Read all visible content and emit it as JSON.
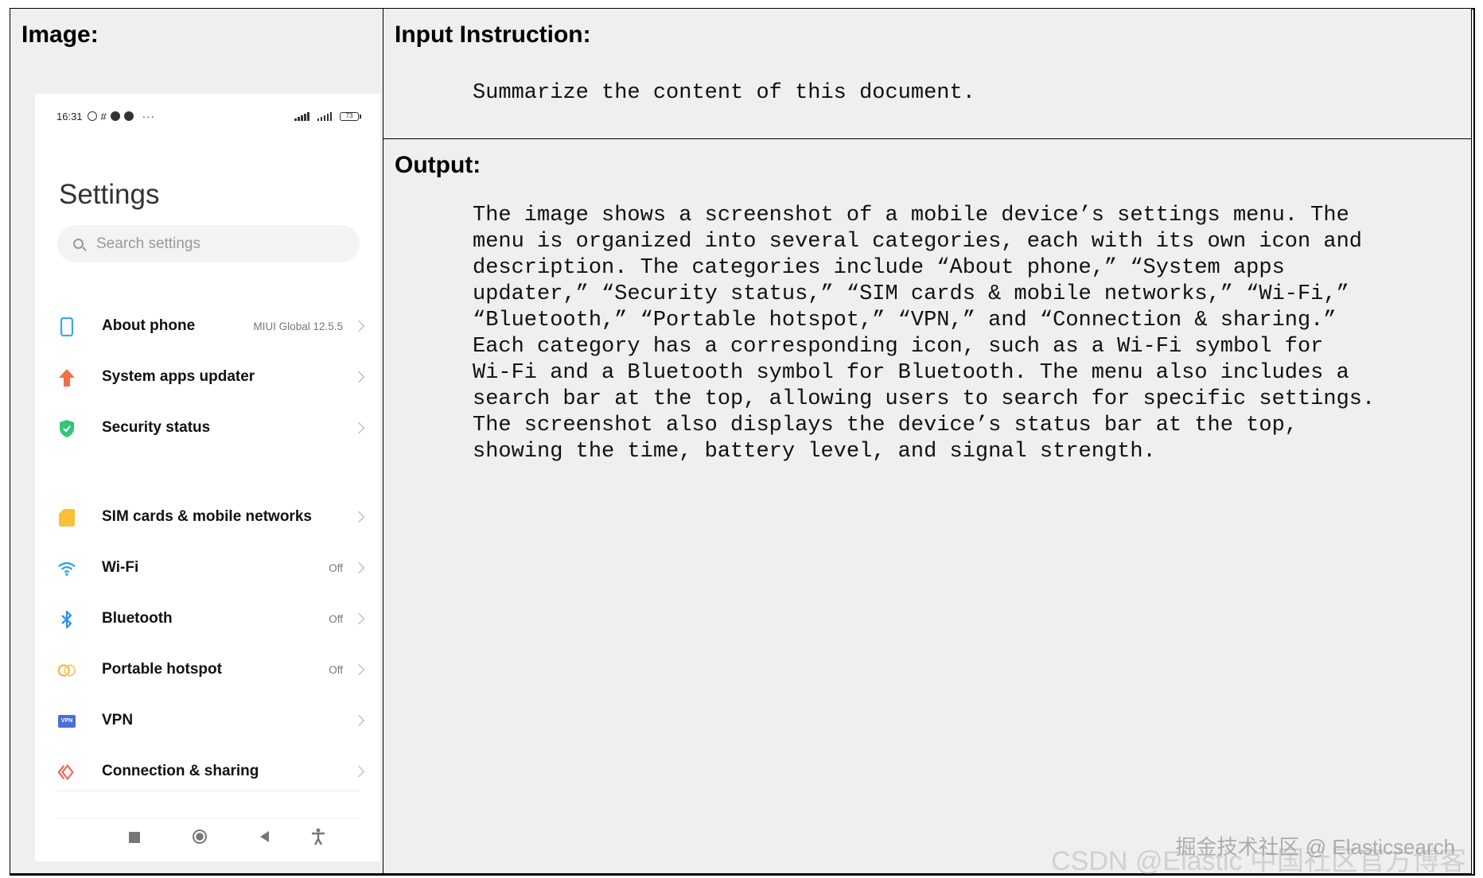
{
  "headers": {
    "image": "Image:",
    "instruction": "Input Instruction:",
    "output": "Output:"
  },
  "instruction_text": "Summarize the content of this document.",
  "output_lines": [
    "The image shows a screenshot of a mobile device’s settings menu. The",
    "menu is organized into several categories, each with its own icon and",
    "description. The categories include “About phone,” “System apps",
    "updater,” “Security status,” “SIM cards & mobile networks,” “Wi-Fi,”",
    "“Bluetooth,” “Portable hotspot,” “VPN,” and “Connection & sharing.”",
    "Each category has a corresponding icon, such as a Wi-Fi symbol for",
    "Wi-Fi and a Bluetooth symbol for Bluetooth. The menu also includes a",
    "search bar at the top, allowing users to search for specific settings.",
    "The screenshot also displays the device’s status bar at the top,",
    "showing the time, battery level, and signal strength."
  ],
  "phone": {
    "status": {
      "time": "16:31",
      "dots": "···",
      "battery": "73"
    },
    "title": "Settings",
    "search_placeholder": "Search settings",
    "items": [
      {
        "label": "About phone",
        "value": "MIUI Global 12.5.5",
        "icon": "phone-icon",
        "color": "#3ba3f5"
      },
      {
        "label": "System apps updater",
        "value": "",
        "icon": "arrow-up-icon",
        "color": "#f36f4b"
      },
      {
        "label": "Security status",
        "value": "",
        "icon": "shield-icon",
        "color": "#34c578"
      },
      {
        "label": "SIM cards & mobile networks",
        "value": "",
        "icon": "sim-card-icon",
        "color": "#f8c135"
      },
      {
        "label": "Wi-Fi",
        "value": "Off",
        "icon": "wifi-icon",
        "color": "#2ea2ee"
      },
      {
        "label": "Bluetooth",
        "value": "Off",
        "icon": "bluetooth-icon",
        "color": "#2f8ee8"
      },
      {
        "label": "Portable hotspot",
        "value": "Off",
        "icon": "hotspot-icon",
        "color": "#f5b642"
      },
      {
        "label": "VPN",
        "value": "",
        "icon": "vpn-icon",
        "color": "#4a6fd9",
        "badge": "VPN"
      },
      {
        "label": "Connection & sharing",
        "value": "",
        "icon": "connection-sharing-icon",
        "color": "#ef6b5a"
      }
    ]
  },
  "watermark": {
    "line1": "掘金技术社区 @ Elasticsearch",
    "line2": "CSDN @Elastic 中国社区官方博客"
  }
}
